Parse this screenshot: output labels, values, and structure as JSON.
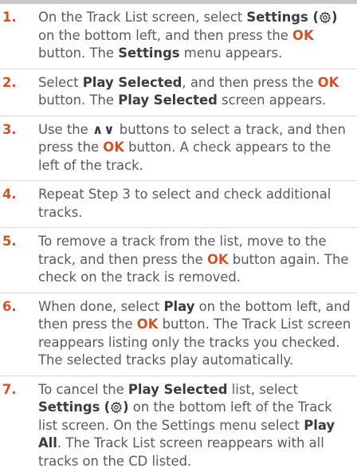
{
  "steps": [
    {
      "num": "1.",
      "t1": "On the Track List screen, select ",
      "b1": "Settings (",
      "b2": ")",
      "t2": " on the bottom left, and then press the ",
      "ok": "OK",
      "t3": " button. The ",
      "b3": "Settings",
      "t4": " menu appears."
    },
    {
      "num": "2.",
      "t1": "Select ",
      "b1": "Play Selected",
      "t2": ", and then press the ",
      "ok": "OK",
      "t3": " button. The ",
      "b2": "Play Selected",
      "t4": " screen appears."
    },
    {
      "num": "3.",
      "t1": "Use the ",
      "arrows": "∧∨",
      "t2": " buttons to select a track, and then press the ",
      "ok": "OK",
      "t3": " button. A check appears to the left of the track."
    },
    {
      "num": "4.",
      "t1": "Repeat Step 3 to select and check additional tracks."
    },
    {
      "num": "5.",
      "t1": "To remove a track from the list, move to the track, and then press the ",
      "ok": "OK",
      "t2": " button again. The check on the track is removed."
    },
    {
      "num": "6.",
      "t1": "When done, select ",
      "b1": "Play",
      "t2": " on the bottom left, and then press the ",
      "ok": "OK",
      "t3": " button. The Track List screen reappears listing only the tracks you checked. The selected tracks play automatically."
    },
    {
      "num": "7.",
      "t1": "To cancel the ",
      "b1": "Play Selected",
      "t2": " list, select ",
      "b2": "Settings",
      "b3": "(",
      "b4": ")",
      "t3": " on the bottom left of the Track list screen. On the Settings menu select ",
      "b5": "Play All",
      "t4": ". The Track List screen reappears with all tracks on the CD listed."
    }
  ],
  "colors": {
    "accent": "#c8552d",
    "text": "#5a5a5a",
    "bold_text": "#3c3c3c",
    "rule": "#d9d9d9"
  },
  "icons": {
    "settings": "gear-icon",
    "arrows": "up-down-arrows-icon"
  }
}
